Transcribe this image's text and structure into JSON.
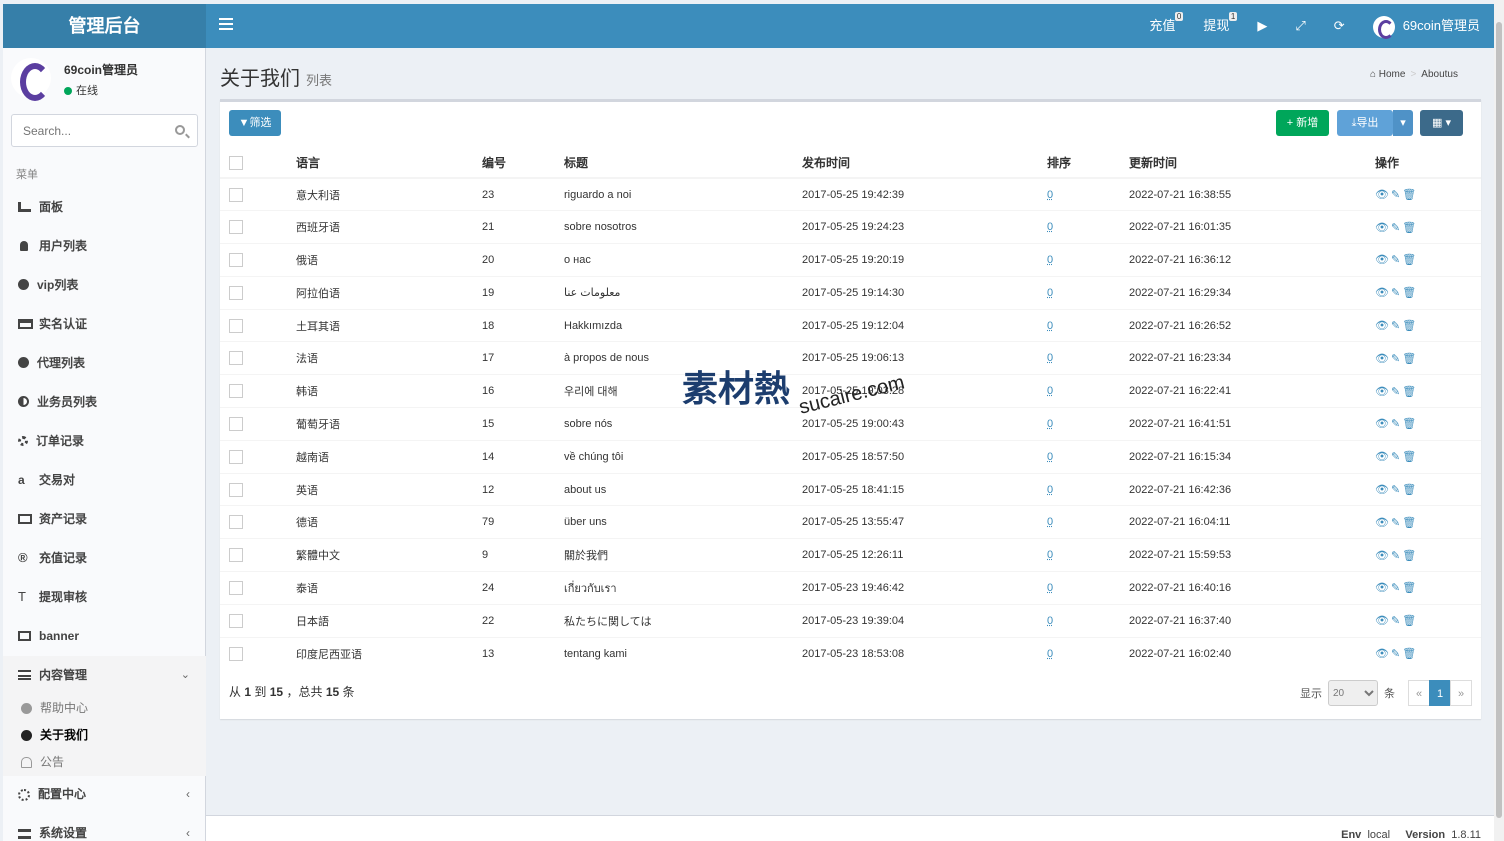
{
  "header": {
    "logo": "管理后台",
    "recharge": "充值",
    "recharge_count": "0",
    "withdraw": "提现",
    "withdraw_count": "1",
    "user": "69coin管理员"
  },
  "sidebar": {
    "user_name": "69coin管理员",
    "status": "在线",
    "search_placeholder": "Search...",
    "menu_header": "菜单",
    "items": [
      {
        "label": "面板",
        "icon": "dashboard-icon"
      },
      {
        "label": "用户列表",
        "icon": "user-icon"
      },
      {
        "label": "vip列表",
        "icon": "check-circle-icon"
      },
      {
        "label": "实名认证",
        "icon": "credit-card-icon"
      },
      {
        "label": "代理列表",
        "icon": "agent-icon"
      },
      {
        "label": "业务员列表",
        "icon": "adjust-icon"
      },
      {
        "label": "订单记录",
        "icon": "gear-icon"
      },
      {
        "label": "交易对",
        "icon": "amazon-icon"
      },
      {
        "label": "资产记录",
        "icon": "money-icon"
      },
      {
        "label": "充值记录",
        "icon": "registered-icon"
      },
      {
        "label": "提现审核",
        "icon": "text-height-icon"
      },
      {
        "label": "banner",
        "icon": "image-icon"
      },
      {
        "label": "内容管理",
        "icon": "list-icon"
      }
    ],
    "sub_items": [
      {
        "label": "帮助中心"
      },
      {
        "label": "关于我们"
      },
      {
        "label": "公告"
      }
    ],
    "more_items": [
      {
        "label": "配置中心"
      },
      {
        "label": "系统设置"
      }
    ]
  },
  "page": {
    "title": "关于我们",
    "subtitle": "列表",
    "breadcrumb_home": "Home",
    "breadcrumb_current": "Aboutus"
  },
  "toolbar": {
    "filter": "筛选",
    "add": "新增",
    "export": "导出"
  },
  "table": {
    "headers": [
      "语言",
      "编号",
      "标题",
      "发布时间",
      "排序",
      "更新时间",
      "操作"
    ],
    "rows": [
      [
        "意大利语",
        "23",
        "riguardo a noi",
        "2017-05-25 19:42:39",
        "0",
        "2022-07-21 16:38:55"
      ],
      [
        "西班牙语",
        "21",
        "sobre nosotros",
        "2017-05-25 19:24:23",
        "0",
        "2022-07-21 16:01:35"
      ],
      [
        "俄语",
        "20",
        "о нас",
        "2017-05-25 19:20:19",
        "0",
        "2022-07-21 16:36:12"
      ],
      [
        "阿拉伯语",
        "19",
        "معلومات عنا",
        "2017-05-25 19:14:30",
        "0",
        "2022-07-21 16:29:34"
      ],
      [
        "土耳其语",
        "18",
        "Hakkımızda",
        "2017-05-25 19:12:04",
        "0",
        "2022-07-21 16:26:52"
      ],
      [
        "法语",
        "17",
        "à propos de nous",
        "2017-05-25 19:06:13",
        "0",
        "2022-07-21 16:23:34"
      ],
      [
        "韩语",
        "16",
        "우리에 대해",
        "2017-05-25 19:03:28",
        "0",
        "2022-07-21 16:22:41"
      ],
      [
        "葡萄牙语",
        "15",
        "sobre nós",
        "2017-05-25 19:00:43",
        "0",
        "2022-07-21 16:41:51"
      ],
      [
        "越南语",
        "14",
        "về chúng tôi",
        "2017-05-25 18:57:50",
        "0",
        "2022-07-21 16:15:34"
      ],
      [
        "英语",
        "12",
        "about us",
        "2017-05-25 18:41:15",
        "0",
        "2022-07-21 16:42:36"
      ],
      [
        "德语",
        "79",
        "über uns",
        "2017-05-25 13:55:47",
        "0",
        "2022-07-21 16:04:11"
      ],
      [
        "繁體中文",
        "9",
        "關於我們",
        "2017-05-25 12:26:11",
        "0",
        "2022-07-21 15:59:53"
      ],
      [
        "泰语",
        "24",
        "เกี่ยวกับเรา",
        "2017-05-23 19:46:42",
        "0",
        "2022-07-21 16:40:16"
      ],
      [
        "日本語",
        "22",
        "私たちに関しては",
        "2017-05-23 19:39:04",
        "0",
        "2022-07-21 16:37:40"
      ],
      [
        "印度尼西亚语",
        "13",
        "tentang kami",
        "2017-05-23 18:53:08",
        "0",
        "2022-07-21 16:02:40"
      ]
    ]
  },
  "pagination": {
    "info_from": "从",
    "from": "1",
    "info_to": "到",
    "to": "15",
    "info_total": "，总共",
    "total": "15",
    "info_unit": "条",
    "show_label": "显示",
    "per_page": "20",
    "unit": "条",
    "prev": "«",
    "current": "1",
    "next": "»"
  },
  "watermark": {
    "cn": "素材熱",
    "en": "sucaire.com"
  },
  "footer": {
    "env_label": "Env",
    "env": "local",
    "version_label": "Version",
    "version": "1.8.11"
  },
  "colors": {
    "primary": "#3c8dbc",
    "success": "#00a65a",
    "header_dark": "#367fa9"
  }
}
